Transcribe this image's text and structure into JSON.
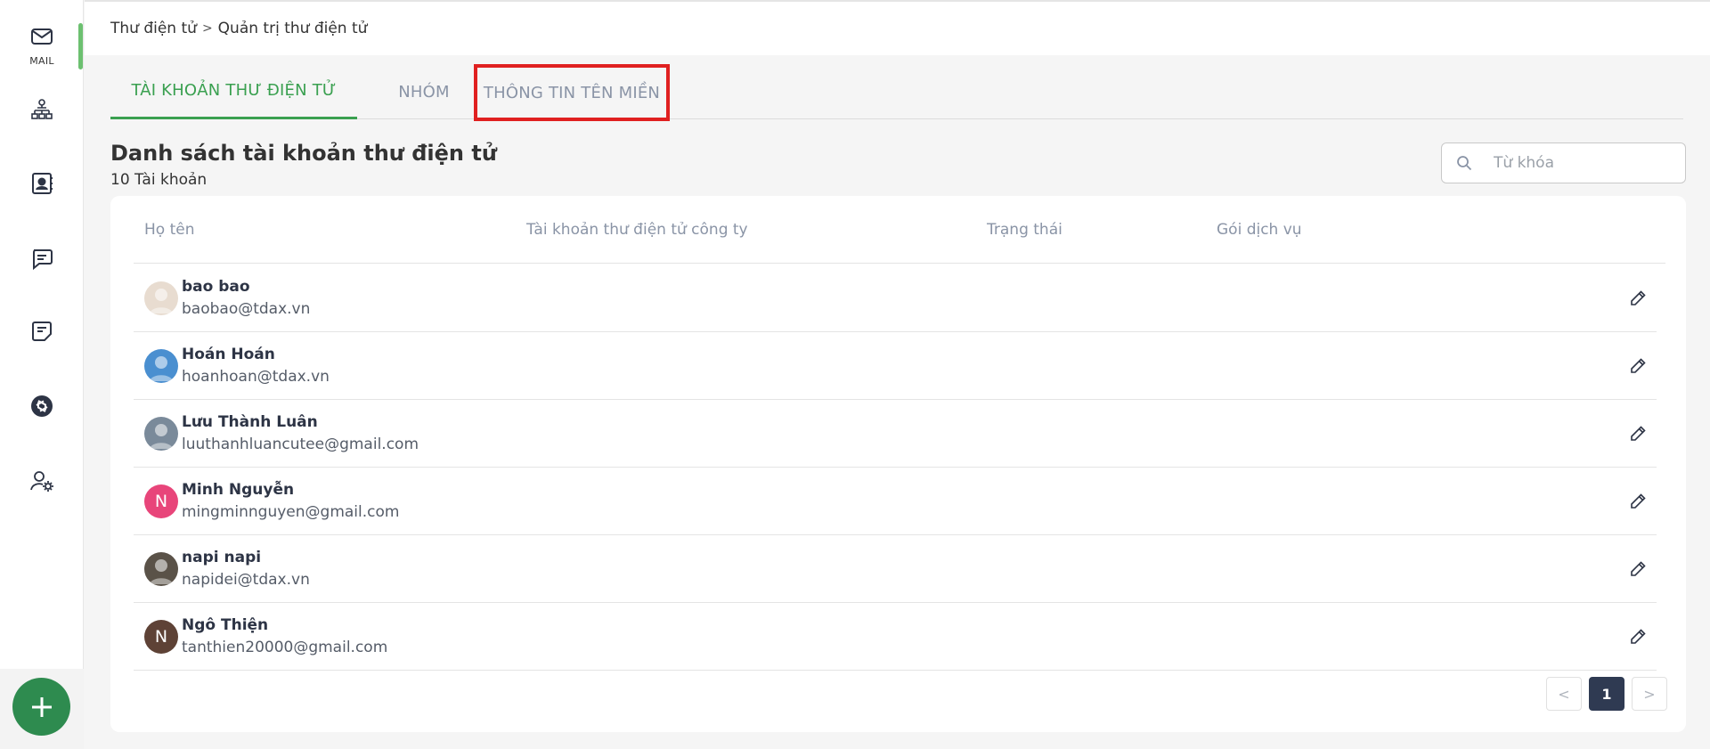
{
  "sidebar": {
    "items": [
      {
        "icon": "mail-icon",
        "label": "MAIL",
        "active": true
      },
      {
        "icon": "org-chart-icon",
        "label": ""
      },
      {
        "icon": "contacts-icon",
        "label": ""
      },
      {
        "icon": "chat-icon",
        "label": ""
      },
      {
        "icon": "notes-icon",
        "label": ""
      },
      {
        "icon": "openai-icon",
        "label": ""
      },
      {
        "icon": "user-settings-icon",
        "label": ""
      }
    ],
    "add_button": "plus-icon"
  },
  "breadcrumb": {
    "parent": "Thư điện tử",
    "separator": ">",
    "current": "Quản trị thư điện tử"
  },
  "tabs": [
    {
      "label": "TÀI KHOẢN THƯ ĐIỆN TỬ",
      "active": true
    },
    {
      "label": "NHÓM",
      "active": false
    },
    {
      "label": "THÔNG TIN TÊN MIỀN",
      "active": false,
      "highlighted": true
    }
  ],
  "list": {
    "title": "Danh sách tài khoản thư điện tử",
    "count": "10 Tài khoản"
  },
  "search": {
    "placeholder": "Từ khóa",
    "value": ""
  },
  "table": {
    "columns": [
      "Họ tên",
      "Tài khoản thư điện tử công ty",
      "Trạng thái",
      "Gói dịch vụ"
    ],
    "rows": [
      {
        "name": "bao bao",
        "email": "baobao@tdax.vn",
        "avatar": "image",
        "avatar_color": "#e8dcd0",
        "initial": ""
      },
      {
        "name": "Hoán Hoán",
        "email": "hoanhoan@tdax.vn",
        "avatar": "image",
        "avatar_color": "#4a8fd0",
        "initial": ""
      },
      {
        "name": "Lưu Thành Luân",
        "email": "luuthanhluancutee@gmail.com",
        "avatar": "image",
        "avatar_color": "#7a8a9a",
        "initial": ""
      },
      {
        "name": "Minh Nguyễn",
        "email": "mingminnguyen@gmail.com",
        "avatar": "initial",
        "avatar_color": "#e8457a",
        "initial": "N"
      },
      {
        "name": "napi napi",
        "email": "napidei@tdax.vn",
        "avatar": "image",
        "avatar_color": "#5a5248",
        "initial": ""
      },
      {
        "name": "Ngô Thiện",
        "email": "tanthien20000@gmail.com",
        "avatar": "initial",
        "avatar_color": "#5e4236",
        "initial": "N"
      }
    ]
  },
  "pagination": {
    "prev": "<",
    "current": "1",
    "next": ">"
  },
  "colors": {
    "accent_green": "#3aa050",
    "fab_green": "#2e8b4f",
    "highlight_red": "#e02020",
    "pager_active": "#2f3a52"
  }
}
